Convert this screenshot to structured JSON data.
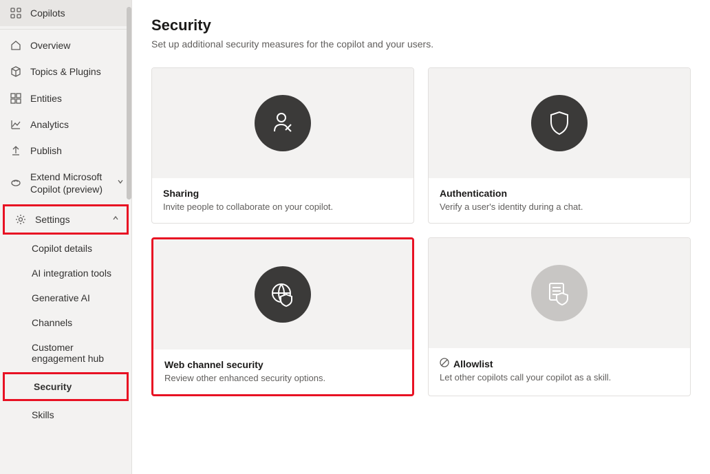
{
  "sidebar": {
    "copilots": "Copilots",
    "overview": "Overview",
    "topics": "Topics & Plugins",
    "entities": "Entities",
    "analytics": "Analytics",
    "publish": "Publish",
    "extend": "Extend Microsoft Copilot (preview)",
    "settings": "Settings",
    "sub": {
      "details": "Copilot details",
      "ai": "AI integration tools",
      "gen": "Generative AI",
      "channels": "Channels",
      "customer": "Customer engagement hub",
      "security": "Security",
      "skills": "Skills"
    }
  },
  "page": {
    "title": "Security",
    "subtitle": "Set up additional security measures for the copilot and your users."
  },
  "cards": {
    "sharing": {
      "title": "Sharing",
      "desc": "Invite people to collaborate on your copilot."
    },
    "auth": {
      "title": "Authentication",
      "desc": "Verify a user's identity during a chat."
    },
    "web": {
      "title": "Web channel security",
      "desc": "Review other enhanced security options."
    },
    "allow": {
      "title": "Allowlist",
      "desc": "Let other copilots call your copilot as a skill."
    }
  }
}
